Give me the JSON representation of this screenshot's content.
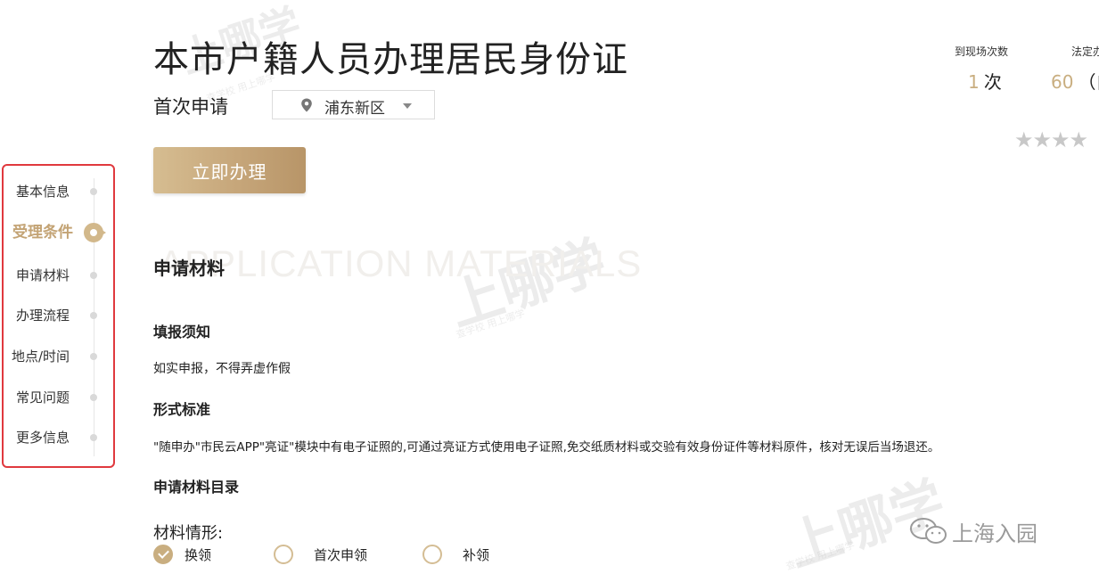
{
  "header": {
    "title": "本市户籍人员办理居民身份证",
    "apply_type": "首次申请",
    "district": "浦东新区",
    "apply_button": "立即办理"
  },
  "stats": [
    {
      "label": "到现场次数",
      "value": "1",
      "unit": "次"
    },
    {
      "label": "法定办",
      "value": "60",
      "unit": "（自"
    }
  ],
  "rating": {
    "stars_text": "★★★★"
  },
  "nav": {
    "items": [
      {
        "label": "基本信息",
        "active": false
      },
      {
        "label": "受理条件",
        "active": true
      },
      {
        "label": "申请材料",
        "active": false
      },
      {
        "label": "办理流程",
        "active": false
      },
      {
        "label": "地点/时间",
        "active": false
      },
      {
        "label": "常见问题",
        "active": false
      },
      {
        "label": "更多信息",
        "active": false
      }
    ]
  },
  "section": {
    "bg_text": "APPLICATION MATERIALS",
    "title": "申请材料",
    "fill_notice_heading": "填报须知",
    "fill_notice_text": "如实申报，不得弄虚作假",
    "format_heading": "形式标准",
    "format_text": "\"随申办\"市民云APP\"亮证\"模块中有电子证照的,可通过亮证方式使用电子证照,免交纸质材料或交验有效身份证件等材料原件，核对无误后当场退还。",
    "catalog_heading": "申请材料目录",
    "situation_label": "材料情形:",
    "options": [
      {
        "label": "换领",
        "checked": true
      },
      {
        "label": "首次申领",
        "checked": false
      },
      {
        "label": "补领",
        "checked": false
      }
    ]
  },
  "watermark": {
    "brand": "上哪学",
    "sub": "查学校 用上哪学",
    "account": "上海入园"
  },
  "colors": {
    "accent_gold": "#c9ae80",
    "nav_border": "#e0393e"
  }
}
